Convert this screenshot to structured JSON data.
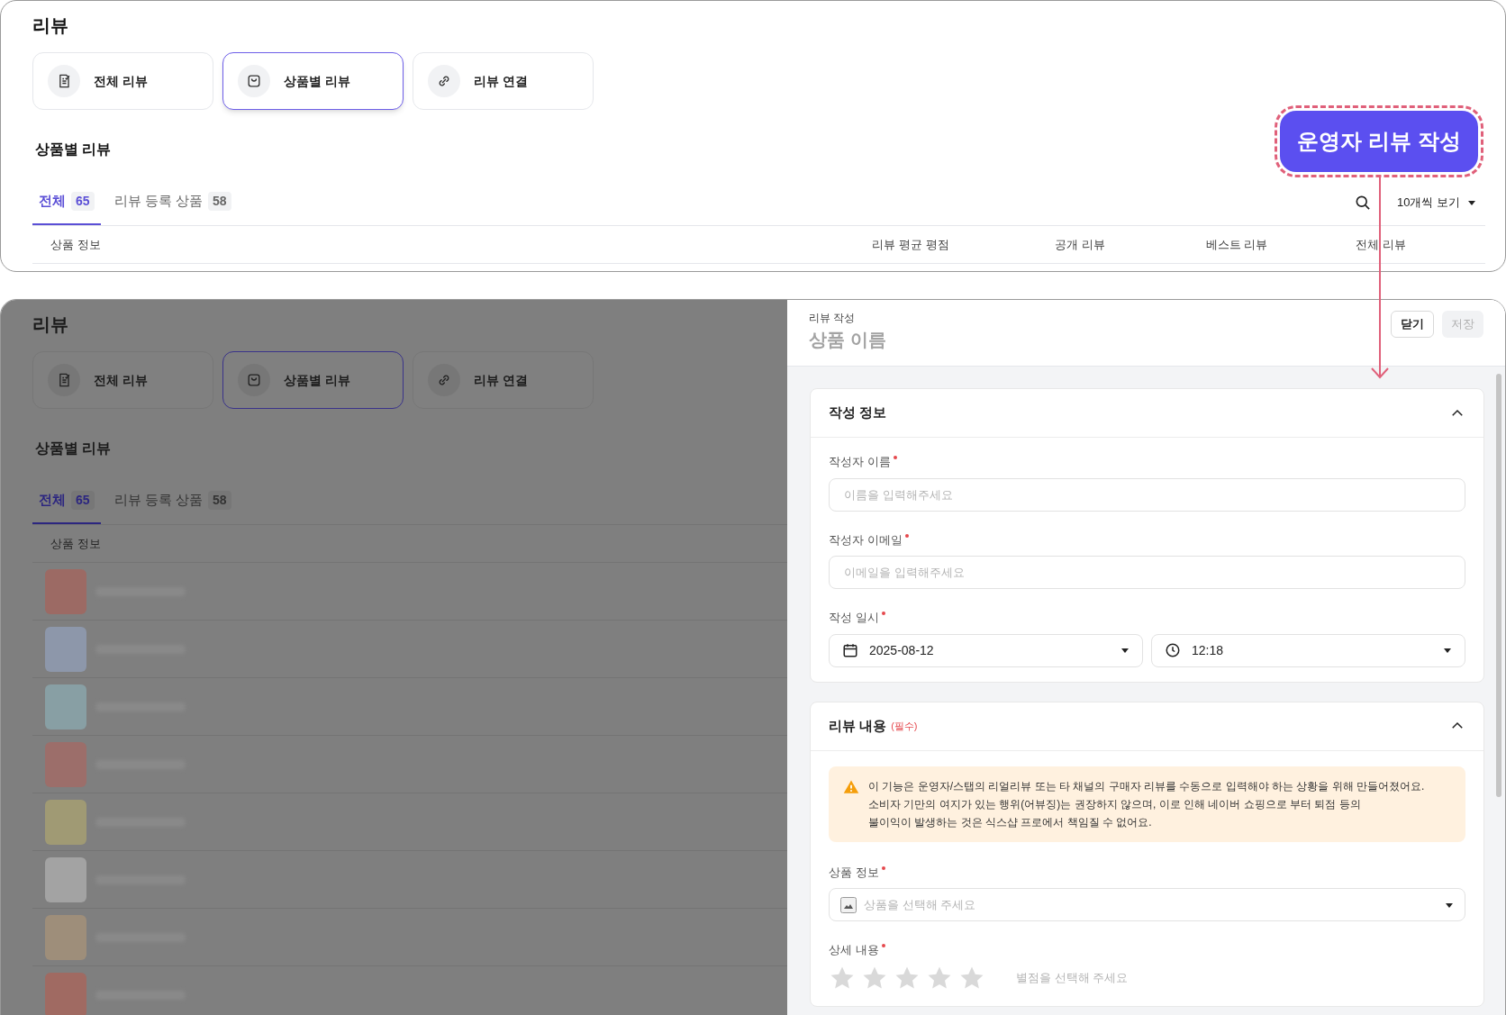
{
  "top_panel": {
    "page_title": "리뷰",
    "nav_cards": [
      {
        "label": "전체 리뷰",
        "selected": false
      },
      {
        "label": "상품별 리뷰",
        "selected": true
      },
      {
        "label": "리뷰 연결",
        "selected": false
      }
    ],
    "section_title": "상품별 리뷰",
    "tabs": [
      {
        "label": "전체",
        "count": "65",
        "selected": true
      },
      {
        "label": "리뷰 등록 상품",
        "count": "58",
        "selected": false
      }
    ],
    "page_size": "10개씩 보기",
    "columns": [
      "상품 정보",
      "리뷰 평균 평점",
      "공개 리뷰",
      "베스트 리뷰",
      "전체 리뷰"
    ],
    "highlighted_button": "운영자 리뷰 작성"
  },
  "bottom_panel": {
    "background_page": {
      "page_title": "리뷰",
      "nav_cards": [
        {
          "label": "전체 리뷰",
          "selected": false
        },
        {
          "label": "상품별 리뷰",
          "selected": true
        },
        {
          "label": "리뷰 연결",
          "selected": false
        }
      ],
      "section_title": "상품별 리뷰",
      "tabs": [
        {
          "label": "전체",
          "count": "65",
          "selected": true
        },
        {
          "label": "리뷰 등록 상품",
          "count": "58",
          "selected": false
        }
      ],
      "columns": [
        "상품 정보"
      ],
      "rows": [
        {
          "color": "#9c6a64"
        },
        {
          "color": "#8d97aa"
        },
        {
          "color": "#889fa4"
        },
        {
          "color": "#9c6e6a"
        },
        {
          "color": "#a09a74"
        },
        {
          "color": "#a3a3a3"
        },
        {
          "color": "#9e8e7a"
        },
        {
          "color": "#a06a62"
        }
      ]
    },
    "drawer": {
      "eyebrow": "리뷰 작성",
      "title": "상품 이름",
      "buttons": [
        {
          "label": "닫기",
          "disabled": false
        },
        {
          "label": "저장",
          "disabled": true
        }
      ],
      "sections": [
        {
          "title": "작성 정보",
          "expanded": true,
          "fields": [
            {
              "kind": "text",
              "label": "작성자 이름",
              "required": true,
              "placeholder": "이름을 입력해주세요"
            },
            {
              "kind": "text",
              "label": "작성자 이메일",
              "required": true,
              "placeholder": "이메일을 입력해주세요"
            },
            {
              "kind": "datetime",
              "label": "작성 일시",
              "required": true,
              "date": "2025-08-12",
              "time": "12:18"
            }
          ]
        },
        {
          "title": "리뷰 내용",
          "badge": "(필수)",
          "expanded": true,
          "notice": [
            "이 기능은 운영자/스탭의 리얼리뷰 또는 타 채널의 구매자 리뷰를 수동으로 입력해야 하는 상황을 위해 만들어졌어요.",
            "소비자 기만의 여지가 있는 행위(어뷰징)는 권장하지 않으며, 이로 인해 네이버 쇼핑으로 부터 퇴점 등의",
            "불이익이 발생하는 것은 식스샵 프로에서 책임질 수 없어요."
          ],
          "fields": [
            {
              "kind": "select",
              "label": "상품 정보",
              "required": true,
              "placeholder": "상품을 선택해 주세요"
            },
            {
              "kind": "rating",
              "label": "상세 내용",
              "required": true,
              "stars": 0,
              "hint": "별점을 선택해 주세요"
            }
          ]
        }
      ]
    }
  }
}
